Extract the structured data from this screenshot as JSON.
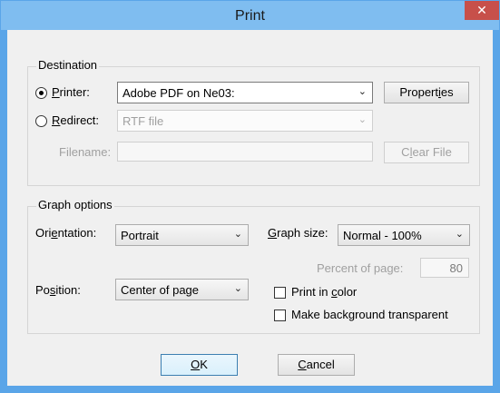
{
  "window": {
    "title": "Print",
    "close_glyph": "✕"
  },
  "destination": {
    "group_label": "Destination",
    "printer_radio": {
      "label_accel": "P",
      "label_rest": "rinter:",
      "selected": true
    },
    "printer_combo": {
      "value": "Adobe PDF on Ne03:",
      "icon": "chevron-down"
    },
    "properties_button": {
      "label_pre": "Propert",
      "label_accel": "i",
      "label_post": "es"
    },
    "redirect_radio": {
      "label_accel": "R",
      "label_rest": "edirect:",
      "selected": false
    },
    "redirect_combo": {
      "value": "RTF file",
      "icon": "chevron-down",
      "enabled": false
    },
    "filename_label": "Filename:",
    "filename_value": "",
    "clear_file_button": {
      "label_pre": "C",
      "label_accel": "l",
      "label_post": "ear File",
      "enabled": false
    }
  },
  "graph_options": {
    "group_label": "Graph options",
    "orientation": {
      "label_pre": "Ori",
      "label_accel": "e",
      "label_post": "ntation:",
      "value": "Portrait"
    },
    "graph_size": {
      "label_pre": "",
      "label_accel": "G",
      "label_post": "raph size:",
      "value": "Normal - 100%"
    },
    "percent_of_page": {
      "label": "Percent of page:",
      "value": "80",
      "enabled": false
    },
    "position": {
      "label_pre": "Po",
      "label_accel": "s",
      "label_post": "ition:",
      "value": "Center of page"
    },
    "print_in_color": {
      "label_pre": "Print in ",
      "label_accel": "c",
      "label_post": "olor",
      "checked": false
    },
    "make_background_transparent": {
      "label": "Make background transparent",
      "checked": false
    }
  },
  "buttons": {
    "ok": {
      "label_accel": "O",
      "label_post": "K"
    },
    "cancel": {
      "label_accel": "C",
      "label_post": "ancel"
    }
  },
  "colors": {
    "titlebar": "#7fbdf0",
    "frame": "#5aa5e8",
    "close_button": "#c7504a",
    "dialog_background": "#f0f0f0"
  }
}
